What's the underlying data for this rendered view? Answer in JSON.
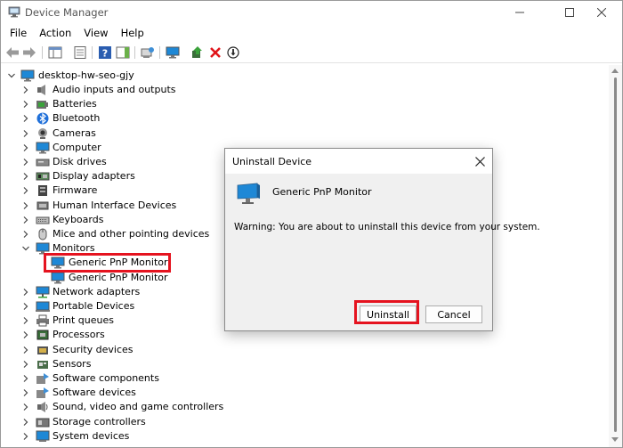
{
  "window": {
    "title": "Device Manager",
    "app_icon": "device-manager-icon",
    "controls": [
      "minimize",
      "maximize",
      "close"
    ]
  },
  "menu": [
    "File",
    "Action",
    "View",
    "Help"
  ],
  "toolbar": {
    "buttons": [
      "back-icon",
      "forward-icon",
      "show-hide-console-tree-icon",
      "properties-icon",
      "help-icon",
      "show-action-pane-icon",
      "scan-hardware-icon",
      "monitor-icon",
      "update-driver-icon",
      "uninstall-icon",
      "disable-device-icon"
    ]
  },
  "tree": {
    "root": "desktop-hw-seo-gjy",
    "categories": [
      {
        "label": "Audio inputs and outputs",
        "icon": "speaker-icon"
      },
      {
        "label": "Batteries",
        "icon": "battery-icon"
      },
      {
        "label": "Bluetooth",
        "icon": "bluetooth-icon"
      },
      {
        "label": "Cameras",
        "icon": "camera-icon"
      },
      {
        "label": "Computer",
        "icon": "computer-icon"
      },
      {
        "label": "Disk drives",
        "icon": "disk-drive-icon"
      },
      {
        "label": "Display adapters",
        "icon": "display-adapter-icon"
      },
      {
        "label": "Firmware",
        "icon": "firmware-icon"
      },
      {
        "label": "Human Interface Devices",
        "icon": "hid-icon"
      },
      {
        "label": "Keyboards",
        "icon": "keyboard-icon"
      },
      {
        "label": "Mice and other pointing devices",
        "icon": "mouse-icon"
      },
      {
        "label": "Monitors",
        "icon": "monitor-icon",
        "expanded": true,
        "children": [
          "Generic PnP Monitor",
          "Generic PnP Monitor"
        ]
      },
      {
        "label": "Network adapters",
        "icon": "network-icon"
      },
      {
        "label": "Portable Devices",
        "icon": "portable-device-icon"
      },
      {
        "label": "Print queues",
        "icon": "printer-icon"
      },
      {
        "label": "Processors",
        "icon": "processor-icon"
      },
      {
        "label": "Security devices",
        "icon": "security-icon"
      },
      {
        "label": "Sensors",
        "icon": "sensor-icon"
      },
      {
        "label": "Software components",
        "icon": "software-component-icon"
      },
      {
        "label": "Software devices",
        "icon": "software-device-icon"
      },
      {
        "label": "Sound, video and game controllers",
        "icon": "sound-icon"
      },
      {
        "label": "Storage controllers",
        "icon": "storage-icon"
      },
      {
        "label": "System devices",
        "icon": "system-icon"
      }
    ]
  },
  "dialog": {
    "title": "Uninstall Device",
    "device_name": "Generic PnP Monitor",
    "warning": "Warning: You are about to uninstall this device from your system.",
    "uninstall_label": "Uninstall",
    "cancel_label": "Cancel"
  },
  "colors": {
    "highlight": "#e5131f",
    "monitor_blue": "#1e88d6"
  }
}
